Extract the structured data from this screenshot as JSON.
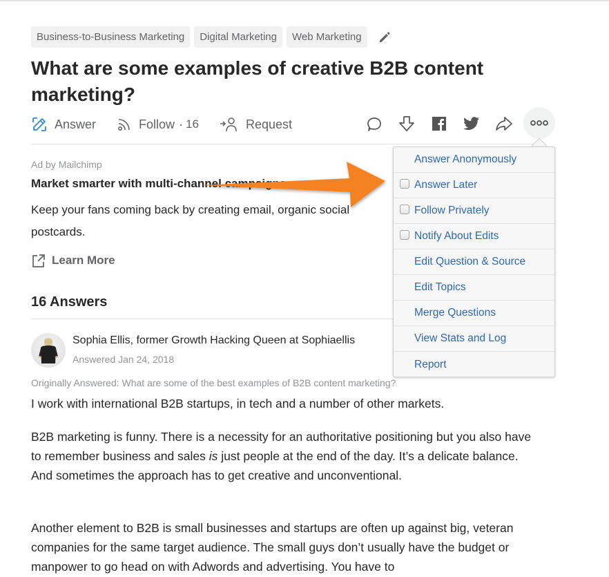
{
  "topics": [
    "Business-to-Business Marketing",
    "Digital Marketing",
    "Web Marketing"
  ],
  "question": {
    "title": "What are some examples of creative B2B content marketing?"
  },
  "actions": {
    "answer": "Answer",
    "follow": "Follow",
    "follow_separator": "·",
    "follow_count": "16",
    "request": "Request"
  },
  "ad": {
    "by": "Ad by Mailchimp",
    "title": "Market smarter with multi-channel campaigns",
    "body": "Keep your fans coming back by creating email, organic social\npostcards.",
    "cta": "Learn More"
  },
  "answers": {
    "heading": "16 Answers",
    "items": [
      {
        "author": "Sophia Ellis, former Growth Hacking Queen at Sophiaellis",
        "date": "Answered Jan 24, 2018",
        "originally": "Originally Answered: What are some of the best examples of B2B content marketing?",
        "p1": "I work with international B2B startups, in tech and a number of other markets.",
        "p2_a": "B2B marketing is funny. There is a necessity for an authoritative positioning but you also have to remember business and sales ",
        "p2_em": "is",
        "p2_b": " just people at the end of the day. It’s a delicate balance. And sometimes the approach has to get creative and unconventional.",
        "p3": "Another element to B2B is small businesses and startups are often up against big, veteran companies for the same target audience. The small guys don’t usually have the budget or manpower to go head on with Adwords and advertising. You have to"
      }
    ]
  },
  "menu": {
    "items": [
      {
        "label": "Answer Anonymously",
        "checkbox": false
      },
      {
        "label": "Answer Later",
        "checkbox": true,
        "checked": false
      },
      {
        "label": "Follow Privately",
        "checkbox": true,
        "checked": false
      },
      {
        "label": "Notify About Edits",
        "checkbox": true,
        "checked": false
      },
      {
        "label": "Edit Question & Source",
        "checkbox": false
      },
      {
        "label": "Edit Topics",
        "checkbox": false
      },
      {
        "label": "Merge Questions",
        "checkbox": false
      },
      {
        "label": "View Stats and Log",
        "checkbox": false
      },
      {
        "label": "Report",
        "checkbox": false
      }
    ]
  },
  "colors": {
    "link_blue": "#2e69b1",
    "answer_icon_blue": "#2e8ae6",
    "annotation_arrow": "#f58220"
  }
}
